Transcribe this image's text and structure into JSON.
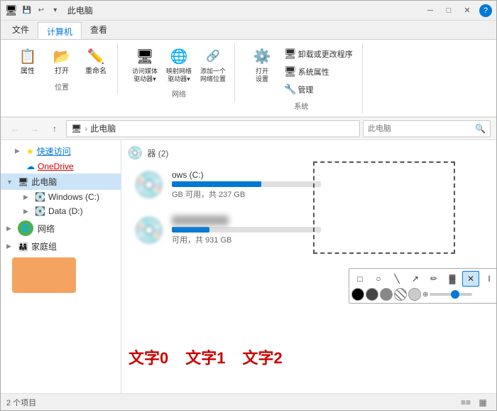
{
  "window": {
    "title": "此电脑",
    "quick_access_buttons": [
      "⬛",
      "↩",
      "▾"
    ]
  },
  "ribbon": {
    "tabs": [
      "文件",
      "计算机",
      "查看"
    ],
    "active_tab": "计算机",
    "groups": {
      "location": {
        "label": "位置",
        "buttons": [
          {
            "label": "属性",
            "icon": "📋"
          },
          {
            "label": "打开",
            "icon": "📁"
          },
          {
            "label": "重命名",
            "icon": "✏️"
          }
        ]
      },
      "network": {
        "label": "网络",
        "buttons": [
          {
            "label": "访问媒体\n驱动器▾",
            "icon": "🖥"
          },
          {
            "label": "映射网络\n驱动器▾",
            "icon": "🌐"
          },
          {
            "label": "添加一个\n网络位置",
            "icon": "➕"
          }
        ]
      },
      "system": {
        "label": "系统",
        "buttons_top": [
          {
            "label": "卸载或更改程序",
            "icon": "⚙️"
          },
          {
            "label": "系统属性",
            "icon": "🖥"
          },
          {
            "label": "管理",
            "icon": "🔧"
          }
        ],
        "open_settings": "打开\n设置"
      }
    }
  },
  "nav": {
    "back_label": "←",
    "forward_label": "→",
    "up_label": "↑",
    "address_parts": [
      "此电脑"
    ],
    "search_placeholder": "此电脑"
  },
  "sidebar": {
    "items": [
      {
        "id": "quick-access",
        "label": "快速访问",
        "indent": 1,
        "expand": "▶",
        "highlight": true,
        "highlight_color": "blue"
      },
      {
        "id": "onedrive",
        "label": "OneDrive",
        "indent": 1,
        "expand": "",
        "highlight": true,
        "highlight_color": "red"
      },
      {
        "id": "this-pc",
        "label": "此电脑",
        "indent": 0,
        "expand": "▼",
        "selected": true
      },
      {
        "id": "windows-c",
        "label": "Windows (C:)",
        "indent": 2,
        "expand": "▶"
      },
      {
        "id": "data-d",
        "label": "Data (D:)",
        "indent": 2,
        "expand": "▶"
      },
      {
        "id": "network",
        "label": "网络",
        "indent": 0,
        "expand": "▶",
        "has_green_dot": true
      },
      {
        "id": "home-group",
        "label": "家庭组",
        "indent": 0,
        "expand": "▶"
      }
    ]
  },
  "file_area": {
    "section_label": "器 (2)",
    "drives": [
      {
        "name": "ows (C:)",
        "space_free": "GB 可用，共 237 GB",
        "bar_percent": 60,
        "blurred": true
      },
      {
        "name": "",
        "space_free": "可用，共 931 GB",
        "bar_percent": 25,
        "blurred": true
      }
    ]
  },
  "annotation_toolbar": {
    "row1": [
      "□",
      "○",
      "╲",
      "╱",
      "✏",
      "▓",
      "✕",
      "I",
      "◈",
      "↩",
      "↪",
      "💾",
      "✓"
    ],
    "colors": [
      "#000000",
      "#333333",
      "#666666",
      "#9999cc"
    ],
    "slider_value": 50
  },
  "bottom_labels": [
    {
      "text": "文字0",
      "color": "#cc0000"
    },
    {
      "text": "文字1",
      "color": "#cc0000"
    },
    {
      "text": "文字2",
      "color": "#cc0000"
    }
  ],
  "status": {
    "count": "2 个项目",
    "view_icons": [
      "≡≡",
      "▦"
    ]
  }
}
